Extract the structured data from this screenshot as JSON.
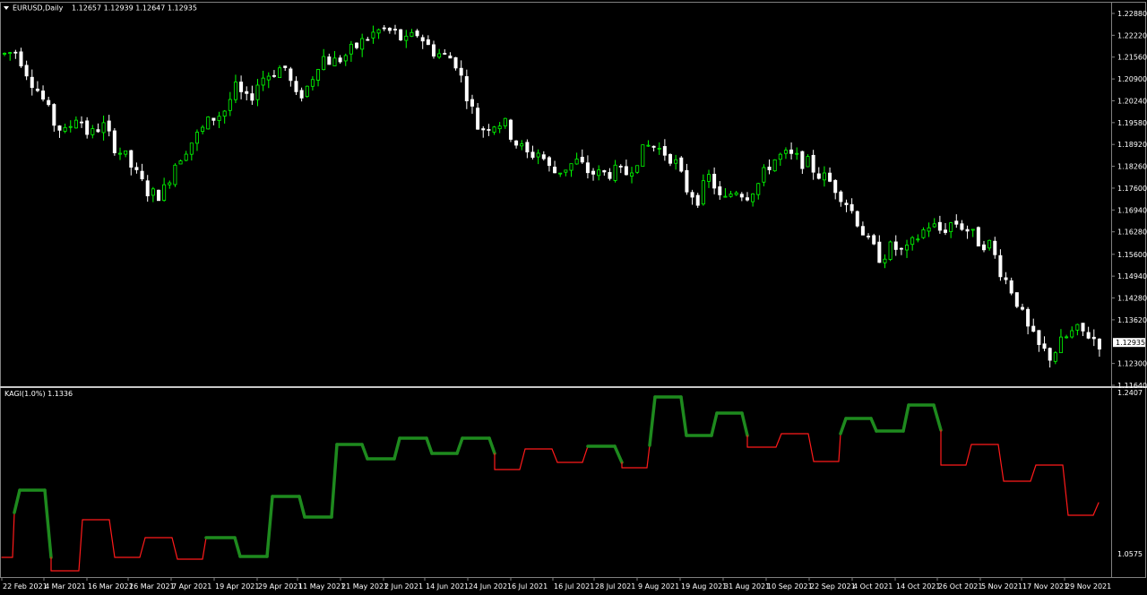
{
  "window": {
    "main_title": "EURUSD,Daily",
    "ohlc_text": "1.12657 1.12939 1.12647 1.12935",
    "indicator_title": "KAGI(1.0%) 1.1336"
  },
  "colors": {
    "background": "#000000",
    "bull_candle": "#00ff00",
    "bear_candle": "#ffffff",
    "kagi_yang": "#1e8a1e",
    "kagi_yin": "#ff1a1a",
    "border": "#808080",
    "current_price_bg": "#ffffff"
  },
  "chart_data": [
    {
      "type": "candlestick",
      "symbol": "EURUSD",
      "timeframe": "Daily",
      "current_price": 1.12935,
      "ylim": [
        1.1164,
        1.2288
      ],
      "price_ticks": [
        "1.22880",
        "1.22220",
        "1.21560",
        "1.20900",
        "1.20240",
        "1.19580",
        "1.18920",
        "1.18260",
        "1.17600",
        "1.16940",
        "1.16280",
        "1.15600",
        "1.14940",
        "1.14280",
        "1.13620",
        "1.12935",
        "1.12300",
        "1.11640"
      ],
      "date_ticks": [
        "22 Feb 2021",
        "4 Mar 2021",
        "16 Mar 2021",
        "26 Mar 2021",
        "7 Apr 2021",
        "19 Apr 2021",
        "29 Apr 2021",
        "11 May 2021",
        "21 May 2021",
        "2 Jun 2021",
        "14 Jun 2021",
        "24 Jun 2021",
        "6 Jul 2021",
        "16 Jul 2021",
        "28 Jul 2021",
        "9 Aug 2021",
        "19 Aug 2021",
        "31 Aug 2021",
        "10 Sep 2021",
        "22 Sep 2021",
        "4 Oct 2021",
        "14 Oct 2021",
        "26 Oct 2021",
        "5 Nov 2021",
        "17 Nov 2021",
        "29 Nov 2021"
      ],
      "close_path": [
        1.2165,
        1.2175,
        1.21,
        1.204,
        1.196,
        1.1925,
        1.1985,
        1.1915,
        1.1955,
        1.189,
        1.185,
        1.179,
        1.174,
        1.1745,
        1.1835,
        1.1885,
        1.1925,
        1.197,
        1.199,
        1.206,
        1.202,
        1.209,
        1.211,
        1.213,
        1.203,
        1.207,
        1.216,
        1.214,
        1.216,
        1.219,
        1.222,
        1.224,
        1.223,
        1.22,
        1.223,
        1.218,
        1.216,
        1.215,
        1.2045,
        1.1935,
        1.1955,
        1.196,
        1.19,
        1.186,
        1.187,
        1.1805,
        1.182,
        1.184,
        1.181,
        1.18,
        1.181,
        1.18,
        1.185,
        1.189,
        1.1875,
        1.185,
        1.176,
        1.173,
        1.18,
        1.171,
        1.176,
        1.174,
        1.1775,
        1.184,
        1.186,
        1.185,
        1.1835,
        1.18,
        1.1775,
        1.173,
        1.167,
        1.1595,
        1.155,
        1.1585,
        1.156,
        1.161,
        1.165,
        1.163,
        1.166,
        1.164,
        1.16,
        1.159,
        1.15,
        1.144,
        1.134,
        1.128,
        1.125,
        1.13,
        1.133,
        1.132,
        1.1293
      ]
    },
    {
      "type": "line",
      "indicator": "KAGI",
      "param": "1.0%",
      "value": 1.1336,
      "ylim": [
        1.0575,
        1.2407
      ],
      "ticks": [
        "1.2407",
        "1.0575"
      ]
    }
  ]
}
